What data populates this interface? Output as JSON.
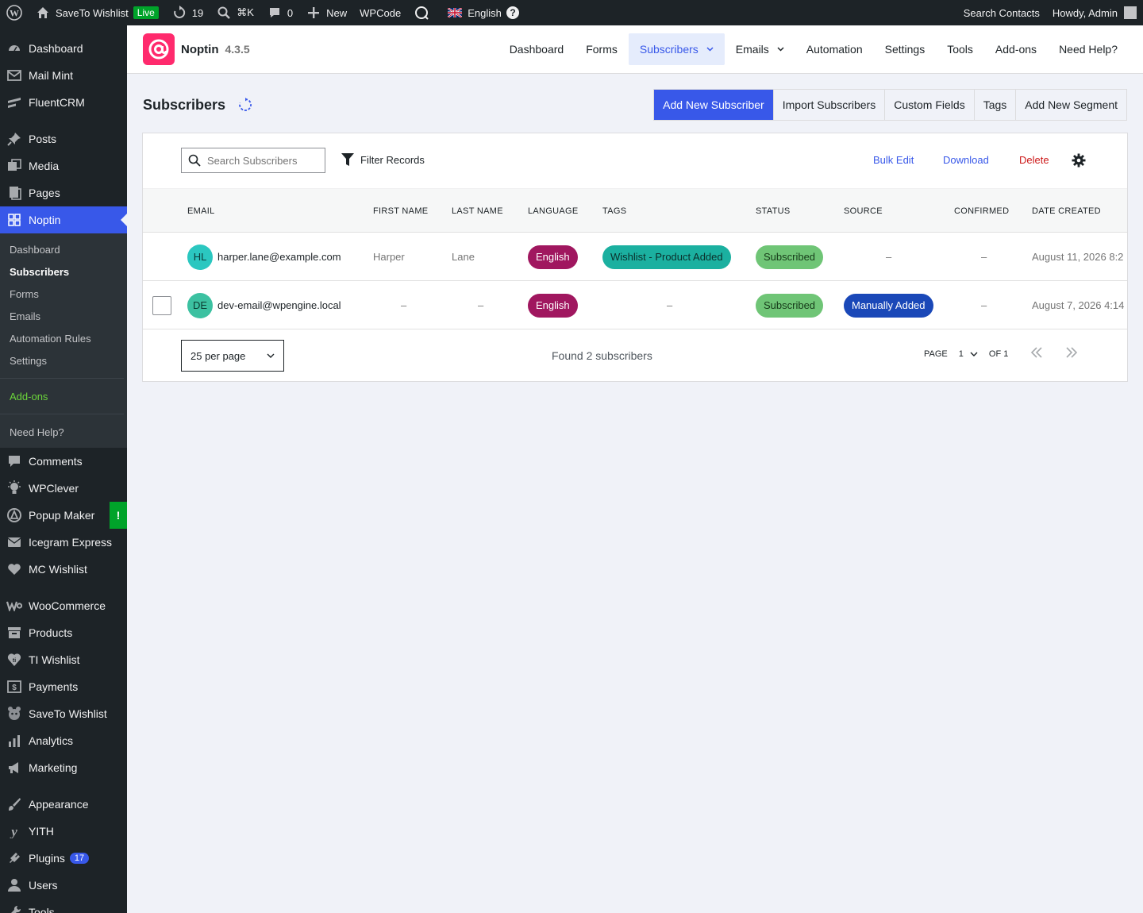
{
  "admin_bar": {
    "site_name": "SaveTo Wishlist",
    "live_label": "Live",
    "updates_count": "19",
    "shortcut": "⌘K",
    "comments_count": "0",
    "new_label": "New",
    "wpcode_label": "WPCode",
    "language_label": "English",
    "search_contacts": "Search Contacts",
    "howdy": "Howdy, Admin"
  },
  "sidebar": {
    "top_items": [
      {
        "label": "Dashboard",
        "icon": "dashboard-icon"
      },
      {
        "label": "Mail Mint",
        "icon": "mail-icon"
      },
      {
        "label": "FluentCRM",
        "icon": "fluentcrm-icon"
      }
    ],
    "content_items": [
      {
        "label": "Posts",
        "icon": "pin-icon"
      },
      {
        "label": "Media",
        "icon": "media-icon"
      },
      {
        "label": "Pages",
        "icon": "pages-icon"
      }
    ],
    "noptin": {
      "label": "Noptin",
      "icon": "grid-icon"
    },
    "noptin_sub": [
      {
        "label": "Dashboard"
      },
      {
        "label": "Subscribers"
      },
      {
        "label": "Forms"
      },
      {
        "label": "Emails"
      },
      {
        "label": "Automation Rules"
      },
      {
        "label": "Settings"
      }
    ],
    "addons_label": "Add-ons",
    "help_label": "Need Help?",
    "plugin_items": [
      {
        "label": "Comments",
        "icon": "comment-icon"
      },
      {
        "label": "WPClever",
        "icon": "bulb-icon"
      },
      {
        "label": "Popup Maker",
        "icon": "popup-icon",
        "alert": "!"
      },
      {
        "label": "Icegram Express",
        "icon": "envelope-icon"
      },
      {
        "label": "MC Wishlist",
        "icon": "heart-icon"
      }
    ],
    "shop_items": [
      {
        "label": "WooCommerce",
        "icon": "woo-icon"
      },
      {
        "label": "Products",
        "icon": "archive-icon"
      },
      {
        "label": "TI Wishlist",
        "icon": "heart-shield-icon"
      },
      {
        "label": "Payments",
        "icon": "dollar-icon"
      },
      {
        "label": "SaveTo Wishlist",
        "icon": "mascot-icon"
      },
      {
        "label": "Analytics",
        "icon": "bar-chart-icon"
      },
      {
        "label": "Marketing",
        "icon": "megaphone-icon"
      }
    ],
    "admin_items": [
      {
        "label": "Appearance",
        "icon": "brush-icon"
      },
      {
        "label": "YITH",
        "icon": "yith-icon"
      },
      {
        "label": "Plugins",
        "icon": "plug-icon",
        "badge": "17"
      },
      {
        "label": "Users",
        "icon": "user-icon"
      },
      {
        "label": "Tools",
        "icon": "wrench-icon"
      }
    ]
  },
  "noptin_header": {
    "brand": "Noptin",
    "version": "4.3.5",
    "nav": [
      {
        "label": "Dashboard"
      },
      {
        "label": "Forms"
      },
      {
        "label": "Subscribers",
        "current": true,
        "dropdown": true
      },
      {
        "label": "Emails",
        "dropdown": true
      },
      {
        "label": "Automation"
      },
      {
        "label": "Settings"
      },
      {
        "label": "Tools"
      },
      {
        "label": "Add-ons"
      },
      {
        "label": "Need Help?"
      }
    ]
  },
  "page": {
    "title": "Subscribers",
    "actions": {
      "add_new": "Add New Subscriber",
      "import": "Import Subscribers",
      "custom_fields": "Custom Fields",
      "tags": "Tags",
      "add_segment": "Add New Segment"
    }
  },
  "toolbar": {
    "search_placeholder": "Search Subscribers",
    "filter_label": "Filter Records",
    "bulk_edit": "Bulk Edit",
    "download": "Download",
    "delete": "Delete"
  },
  "table": {
    "columns": {
      "email": "EMAIL",
      "first_name": "FIRST NAME",
      "last_name": "LAST NAME",
      "language": "LANGUAGE",
      "tags": "TAGS",
      "status": "STATUS",
      "source": "SOURCE",
      "confirmed": "CONFIRMED",
      "date_created": "DATE CREATED"
    },
    "rows": [
      {
        "initials": "HL",
        "email": "harper.lane@example.com",
        "first_name": "Harper",
        "last_name": "Lane",
        "language": "English",
        "tags": "Wishlist - Product Added",
        "status": "Subscribed",
        "source": "–",
        "confirmed": "–",
        "date_created": "August 11, 2026 8:2"
      },
      {
        "initials": "DE",
        "email": "dev-email@wpengine.local",
        "first_name": "–",
        "last_name": "–",
        "language": "English",
        "tags": "–",
        "status": "Subscribed",
        "source": "Manually Added",
        "confirmed": "–",
        "date_created": "August 7, 2026 4:14"
      }
    ]
  },
  "footer": {
    "per_page": "25 per page",
    "found": "Found 2 subscribers",
    "page_label": "PAGE",
    "page_num": "1",
    "of_label": "OF 1"
  },
  "colors": {
    "accent": "#3858e9",
    "language_pill": "#a0175f",
    "tag_pill": "#1bb0a0",
    "status_pill": "#6fc576",
    "source_pill": "#1a48b8",
    "delete": "#cc1818",
    "logo": "#ff2a6d"
  }
}
